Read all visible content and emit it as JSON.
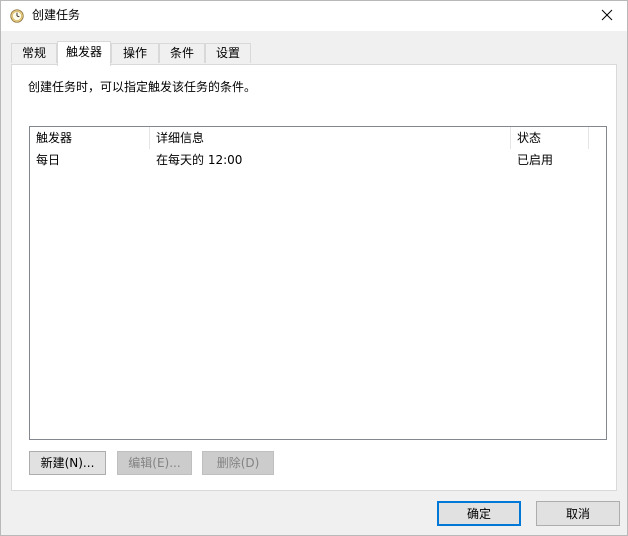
{
  "window": {
    "title": "创建任务"
  },
  "tabs": [
    {
      "label": "常规",
      "active": false
    },
    {
      "label": "触发器",
      "active": true
    },
    {
      "label": "操作",
      "active": false
    },
    {
      "label": "条件",
      "active": false
    },
    {
      "label": "设置",
      "active": false
    }
  ],
  "triggers_panel": {
    "description": "创建任务时，可以指定触发该任务的条件。",
    "columns": [
      "触发器",
      "详细信息",
      "状态"
    ],
    "rows": [
      {
        "trigger": "每日",
        "details": "在每天的 12:00",
        "status": "已启用"
      }
    ],
    "buttons": {
      "new": "新建(N)...",
      "edit": "编辑(E)...",
      "delete": "删除(D)"
    }
  },
  "dialog_buttons": {
    "ok": "确定",
    "cancel": "取消"
  },
  "colors": {
    "accent": "#0078d7",
    "clock_icon": "#e8c169"
  },
  "icons": {
    "title": "clock-icon",
    "close": "close-icon"
  }
}
